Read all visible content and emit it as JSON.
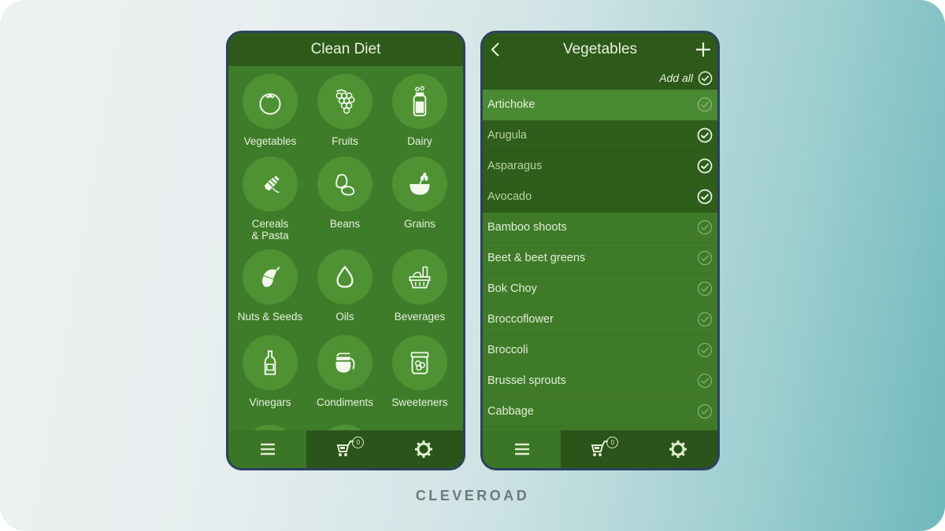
{
  "brand": "CLEVEROAD",
  "left_screen": {
    "title": "Clean Diet",
    "categories": [
      {
        "label": "Vegetables",
        "icon": "tomato-icon"
      },
      {
        "label": "Fruits",
        "icon": "grapes-icon"
      },
      {
        "label": "Dairy",
        "icon": "milk-bottle-icon"
      },
      {
        "label": "Cereals\n& Pasta",
        "icon": "wheat-ear-icon"
      },
      {
        "label": "Beans",
        "icon": "beans-icon"
      },
      {
        "label": "Grains",
        "icon": "grain-bowl-icon"
      },
      {
        "label": "Nuts & Seeds",
        "icon": "acorn-icon"
      },
      {
        "label": "Oils",
        "icon": "oil-drop-icon"
      },
      {
        "label": "Beverages",
        "icon": "basket-icon"
      },
      {
        "label": "Vinegars",
        "icon": "bottle-icon"
      },
      {
        "label": "Condiments",
        "icon": "coffee-pot-icon"
      },
      {
        "label": "Sweeteners",
        "icon": "jar-icon"
      }
    ],
    "tabbar": {
      "cart_count": "0"
    }
  },
  "right_screen": {
    "title": "Vegetables",
    "back_icon": "chevron-left-icon",
    "add_icon": "plus-icon",
    "add_all_label": "Add all",
    "items": [
      {
        "label": "Artichoke",
        "state": "highlighted"
      },
      {
        "label": "Arugula",
        "state": "checked"
      },
      {
        "label": "Asparagus",
        "state": "checked"
      },
      {
        "label": "Avocado",
        "state": "checked"
      },
      {
        "label": "Bamboo shoots",
        "state": "unchecked"
      },
      {
        "label": "Beet & beet greens",
        "state": "unchecked"
      },
      {
        "label": "Bok Choy",
        "state": "unchecked"
      },
      {
        "label": "Broccoflower",
        "state": "unchecked"
      },
      {
        "label": "Broccoli",
        "state": "unchecked"
      },
      {
        "label": "Brussel sprouts",
        "state": "unchecked"
      },
      {
        "label": "Cabbage",
        "state": "unchecked"
      }
    ],
    "tabbar": {
      "cart_count": "0"
    }
  },
  "colors": {
    "header": "#2d5a1a",
    "body": "#3f7c29",
    "circle": "#4e9234",
    "frame": "#2c4160"
  }
}
